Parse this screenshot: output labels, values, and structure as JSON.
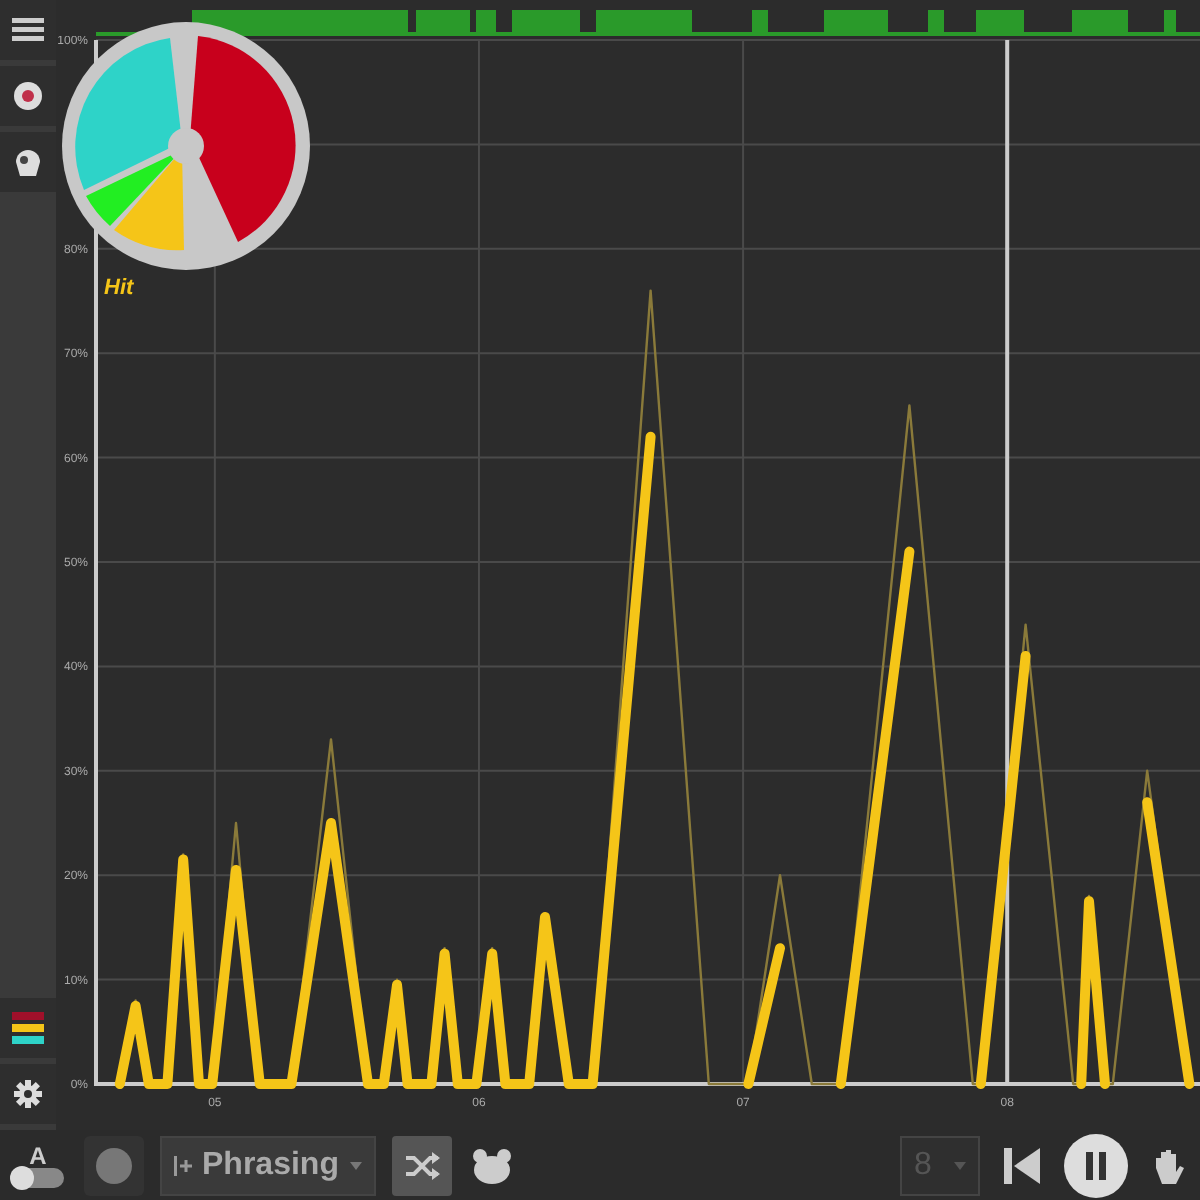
{
  "overlay": {
    "label": "Hit"
  },
  "chart_data": {
    "type": "line",
    "xlim": [
      4.55,
      8.73
    ],
    "ylim": [
      0,
      100
    ],
    "yticks": [
      {
        "value": 0,
        "label": "0%"
      },
      {
        "value": 10,
        "label": "10%"
      },
      {
        "value": 20,
        "label": "20%"
      },
      {
        "value": 30,
        "label": "30%"
      },
      {
        "value": 40,
        "label": "40%"
      },
      {
        "value": 50,
        "label": "50%"
      },
      {
        "value": 60,
        "label": "60%"
      },
      {
        "value": 70,
        "label": "70%"
      },
      {
        "value": 80,
        "label": "80%"
      },
      {
        "value": 100,
        "label": "100%"
      }
    ],
    "xticks": [
      {
        "value": 5,
        "label": "05"
      },
      {
        "value": 6,
        "label": "06"
      },
      {
        "value": 7,
        "label": "07"
      },
      {
        "value": 8,
        "label": "08"
      }
    ],
    "x": [
      4.64,
      4.7,
      4.75,
      4.82,
      4.88,
      4.94,
      4.99,
      5.08,
      5.17,
      5.29,
      5.44,
      5.58,
      5.64,
      5.69,
      5.73,
      5.82,
      5.87,
      5.92,
      5.99,
      6.05,
      6.1,
      6.19,
      6.25,
      6.34,
      6.43,
      6.65,
      6.87,
      7.02,
      7.14,
      7.26,
      7.37,
      7.63,
      7.87,
      7.9,
      8.07,
      8.25,
      8.28,
      8.31,
      8.37,
      8.4,
      8.53,
      8.69
    ],
    "series": [
      {
        "color": "#8a7a3a",
        "values": [
          0,
          8,
          0,
          0,
          22,
          0,
          0,
          25,
          0,
          0,
          33,
          0,
          0,
          10,
          0,
          0,
          13,
          0,
          0,
          13,
          0,
          0,
          16,
          0,
          0,
          76,
          0,
          0,
          20,
          0,
          0,
          65,
          0,
          0,
          44,
          0,
          0,
          18,
          0,
          0,
          30,
          0
        ]
      },
      {
        "color": "#f5c518",
        "values": [
          0,
          7.5,
          0,
          0,
          21.5,
          0,
          0,
          20.5,
          0,
          0,
          25,
          0,
          0,
          9.5,
          0,
          0,
          12.5,
          0,
          0,
          12.5,
          0,
          0,
          16,
          0,
          0,
          62,
          null,
          0,
          13,
          null,
          0,
          51,
          null,
          0,
          41,
          null,
          0,
          17.5,
          0,
          null,
          27,
          0
        ]
      }
    ],
    "grid": true,
    "ref_lines": [
      {
        "axis": "x",
        "value": 8
      }
    ]
  },
  "toolbar": {
    "auto_label": "A",
    "auto_on": false,
    "mode": "Phrasing",
    "shuffle_selected": true,
    "bars": "8",
    "bars_disabled": true
  }
}
